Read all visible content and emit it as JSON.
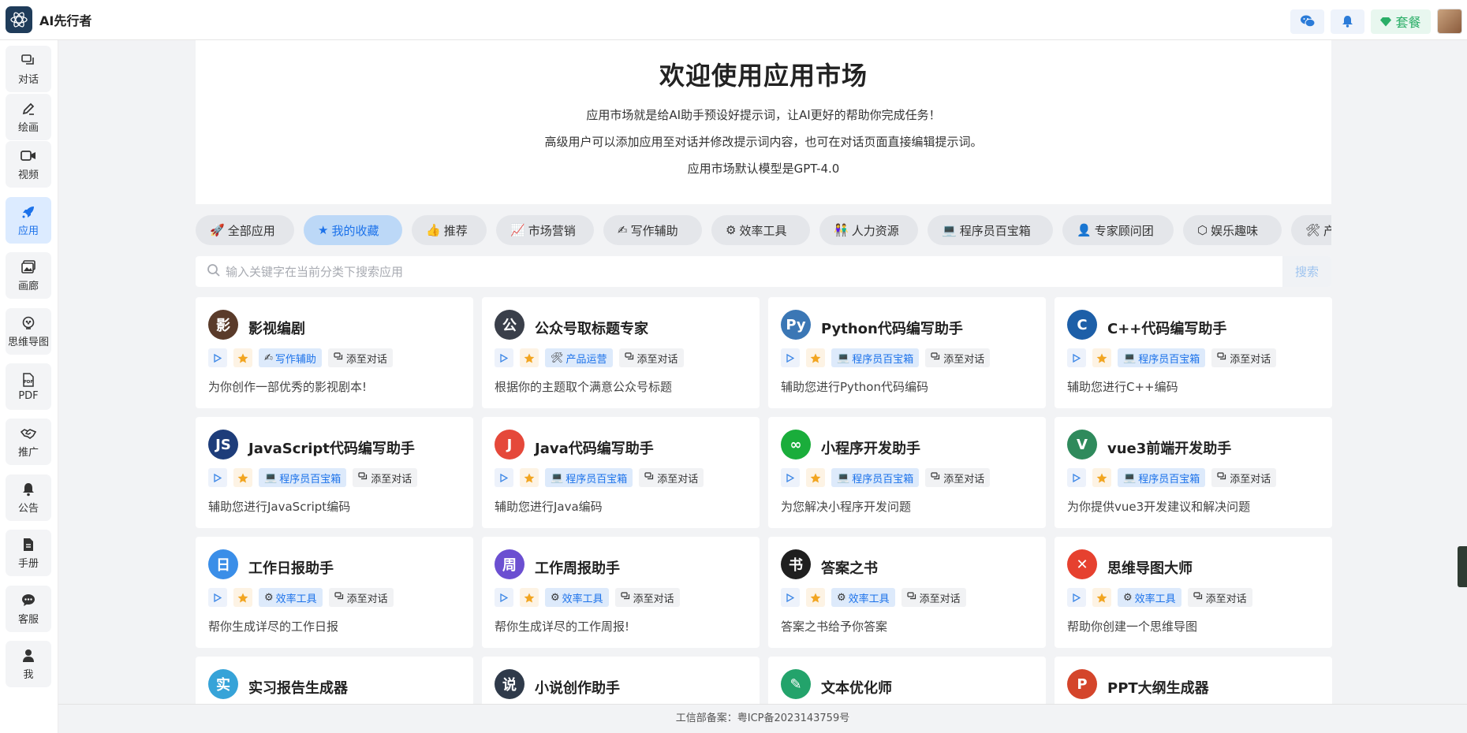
{
  "app": {
    "name": "AI先行者"
  },
  "header": {
    "plan_label": "套餐"
  },
  "sidebar": {
    "items": [
      {
        "label": "对话",
        "icon": "chat-icon"
      },
      {
        "label": "绘画",
        "icon": "pen-icon"
      },
      {
        "label": "视频",
        "icon": "video-icon"
      },
      {
        "label": "应用",
        "icon": "rocket-icon",
        "active": true
      },
      {
        "label": "画廊",
        "icon": "gallery-icon"
      },
      {
        "label": "思维导图",
        "icon": "mindmap-icon"
      },
      {
        "label": "PDF",
        "icon": "pdf-icon"
      },
      {
        "label": "推广",
        "icon": "handshake-icon"
      },
      {
        "label": "公告",
        "icon": "bell-icon"
      },
      {
        "label": "手册",
        "icon": "file-icon"
      },
      {
        "label": "客服",
        "icon": "support-icon"
      },
      {
        "label": "我",
        "icon": "user-icon"
      }
    ]
  },
  "hero": {
    "title": "欢迎使用应用市场",
    "line1": "应用市场就是给AI助手预设好提示词，让AI更好的帮助你完成任务！",
    "line2": "高级用户可以添加应用至对话并修改提示词内容，也可在对话页面直接编辑提示词。",
    "line3": "应用市场默认模型是GPT-4.0"
  },
  "categories": [
    {
      "label": "全部应用",
      "icon": "🚀"
    },
    {
      "label": "我的收藏",
      "icon": "★",
      "active": true
    },
    {
      "label": "推荐",
      "icon": "👍"
    },
    {
      "label": "市场营销",
      "icon": "📈"
    },
    {
      "label": "写作辅助",
      "icon": "✍"
    },
    {
      "label": "效率工具",
      "icon": "⚙"
    },
    {
      "label": "人力资源",
      "icon": "👫"
    },
    {
      "label": "程序员百宝箱",
      "icon": "💻"
    },
    {
      "label": "专家顾问团",
      "icon": "👤"
    },
    {
      "label": "娱乐趣味",
      "icon": "⬡"
    },
    {
      "label": "产",
      "icon": "🛠"
    }
  ],
  "search": {
    "placeholder": "输入关键字在当前分类下搜索应用",
    "button": "搜索"
  },
  "add_label": "添至对话",
  "cards": [
    {
      "title": "影视编剧",
      "tag": "写作辅助",
      "tag_icon": "✍",
      "desc": "为你创作一部优秀的影视剧本!",
      "color": "#5a3b2a",
      "glyph": "影"
    },
    {
      "title": "公众号取标题专家",
      "tag": "产品运营",
      "tag_icon": "🛠",
      "desc": "根据你的主题取个满意公众号标题",
      "color": "#3a3f4a",
      "glyph": "公"
    },
    {
      "title": "Python代码编写助手",
      "tag": "程序员百宝箱",
      "tag_icon": "💻",
      "desc": "辅助您进行Python代码编码",
      "color": "#3b77b5",
      "glyph": "Py"
    },
    {
      "title": "C++代码编写助手",
      "tag": "程序员百宝箱",
      "tag_icon": "💻",
      "desc": "辅助您进行C++编码",
      "color": "#1d5fa8",
      "glyph": "C"
    },
    {
      "title": "JavaScript代码编写助手",
      "tag": "程序员百宝箱",
      "tag_icon": "💻",
      "desc": "辅助您进行JavaScript编码",
      "color": "#1e3d7a",
      "glyph": "JS"
    },
    {
      "title": "Java代码编写助手",
      "tag": "程序员百宝箱",
      "tag_icon": "💻",
      "desc": "辅助您进行Java编码",
      "color": "#e5483a",
      "glyph": "J"
    },
    {
      "title": "小程序开发助手",
      "tag": "程序员百宝箱",
      "tag_icon": "💻",
      "desc": "为您解决小程序开发问题",
      "color": "#1aad3b",
      "glyph": "∞"
    },
    {
      "title": "vue3前端开发助手",
      "tag": "程序员百宝箱",
      "tag_icon": "💻",
      "desc": "为你提供vue3开发建议和解决问题",
      "color": "#2f8a5c",
      "glyph": "V"
    },
    {
      "title": "工作日报助手",
      "tag": "效率工具",
      "tag_icon": "⚙",
      "desc": "帮你生成详尽的工作日报",
      "color": "#3a8ee8",
      "glyph": "日"
    },
    {
      "title": "工作周报助手",
      "tag": "效率工具",
      "tag_icon": "⚙",
      "desc": "帮你生成详尽的工作周报!",
      "color": "#6b4fd1",
      "glyph": "周"
    },
    {
      "title": "答案之书",
      "tag": "效率工具",
      "tag_icon": "⚙",
      "desc": "答案之书给予你答案",
      "color": "#1f1f1f",
      "glyph": "书"
    },
    {
      "title": "思维导图大师",
      "tag": "效率工具",
      "tag_icon": "⚙",
      "desc": "帮助你创建一个思维导图",
      "color": "#e6412f",
      "glyph": "✕"
    },
    {
      "title": "实习报告生成器",
      "tag": "",
      "tag_icon": "",
      "desc": "",
      "color": "#36a3d8",
      "glyph": "实"
    },
    {
      "title": "小说创作助手",
      "tag": "",
      "tag_icon": "",
      "desc": "",
      "color": "#2f3a4a",
      "glyph": "说"
    },
    {
      "title": "文本优化师",
      "tag": "",
      "tag_icon": "",
      "desc": "",
      "color": "#23a36b",
      "glyph": "✎"
    },
    {
      "title": "PPT大纲生成器",
      "tag": "",
      "tag_icon": "",
      "desc": "",
      "color": "#d4452b",
      "glyph": "P"
    }
  ],
  "footer": {
    "icp": "工信部备案：粤ICP备2023143759号"
  },
  "colors": {
    "accent": "#1c72ea",
    "plan": "#2aae67",
    "star": "#f2a520"
  }
}
